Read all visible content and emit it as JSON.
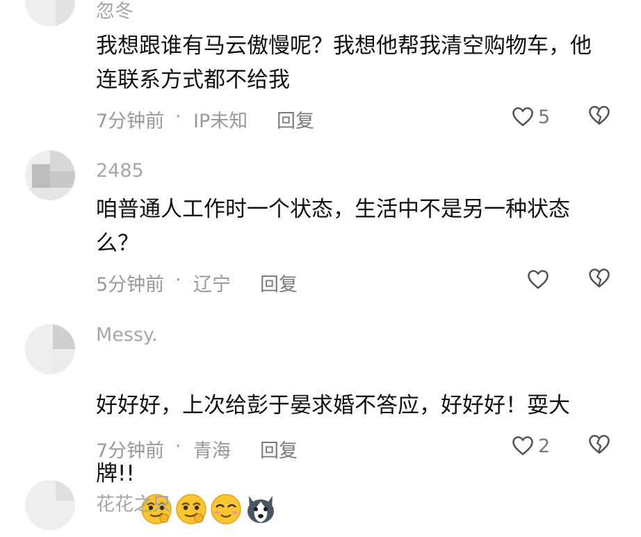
{
  "comments": [
    {
      "username": "忽冬",
      "text": "我想跟谁有马云傲慢呢？我想他帮我清空购物车，他\n连联系方式都不给我",
      "time": "7分钟前",
      "location": "IP未知",
      "reply_label": "回复",
      "likes": "5"
    },
    {
      "username": "2485",
      "text": "咱普通人工作时一个状态，生活中不是另一种状态\n么？",
      "time": "5分钟前",
      "location": "辽宁",
      "reply_label": "回复",
      "likes": ""
    },
    {
      "username": "Messy.",
      "text_line1": "好好好，上次给彭于晏求婚不答应，好好好！耍大",
      "text_line2": "牌!!",
      "emojis": [
        "smirk-emoji",
        "smirk-emoji",
        "blush-smile-emoji",
        "husky-dog-emoji"
      ],
      "time": "7分钟前",
      "location": "青海",
      "reply_label": "回复",
      "likes": "2"
    },
    {
      "username": "花花之只"
    }
  ],
  "separator": "·",
  "icons": {
    "like": "heart-outline-icon",
    "dislike": "broken-heart-icon"
  },
  "colors": {
    "text": "#111111",
    "muted": "#999999",
    "icon": "#555555",
    "emoji_yellow": "#f9c531"
  }
}
